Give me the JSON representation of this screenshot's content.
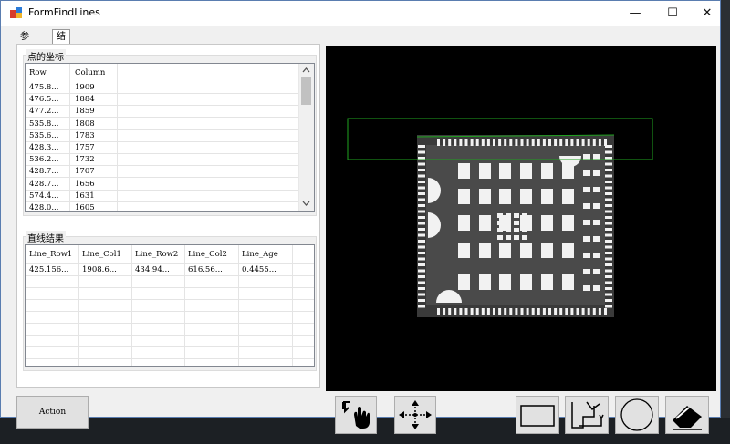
{
  "window": {
    "title": "FormFindLines",
    "min_glyph": "—",
    "max_glyph": "☐",
    "close_glyph": "✕"
  },
  "tabs": [
    {
      "label": "参数",
      "selected": false
    },
    {
      "label": "结果",
      "selected": true
    }
  ],
  "points_group": {
    "label": "点的坐标",
    "columns": [
      "Row",
      "Column"
    ],
    "rows": [
      [
        "475.8...",
        "1909"
      ],
      [
        "476.5...",
        "1884"
      ],
      [
        "477.2...",
        "1859"
      ],
      [
        "535.8...",
        "1808"
      ],
      [
        "535.6...",
        "1783"
      ],
      [
        "428.3...",
        "1757"
      ],
      [
        "536.2...",
        "1732"
      ],
      [
        "428.7...",
        "1707"
      ],
      [
        "428.7...",
        "1656"
      ],
      [
        "574.4...",
        "1631"
      ],
      [
        "428.0...",
        "1605"
      ]
    ]
  },
  "lines_group": {
    "label": "直线结果",
    "columns": [
      "Line_Row1",
      "Line_Col1",
      "Line_Row2",
      "Line_Col2",
      "Line_Age"
    ],
    "rows": [
      [
        "425.156...",
        "1908.6...",
        "434.94...",
        "616.56...",
        "0.4455..."
      ]
    ]
  },
  "action_button": {
    "label": "Action"
  },
  "toolbar": {
    "icons": [
      "hand-pointer-icon",
      "move-arrows-icon",
      "rectangle-icon",
      "rotated-rectangle-icon",
      "circle-icon",
      "eraser-icon"
    ]
  },
  "colors": {
    "roi_green": "#1fa31f",
    "image_bg": "#000000",
    "window_border": "#5a7db0"
  }
}
